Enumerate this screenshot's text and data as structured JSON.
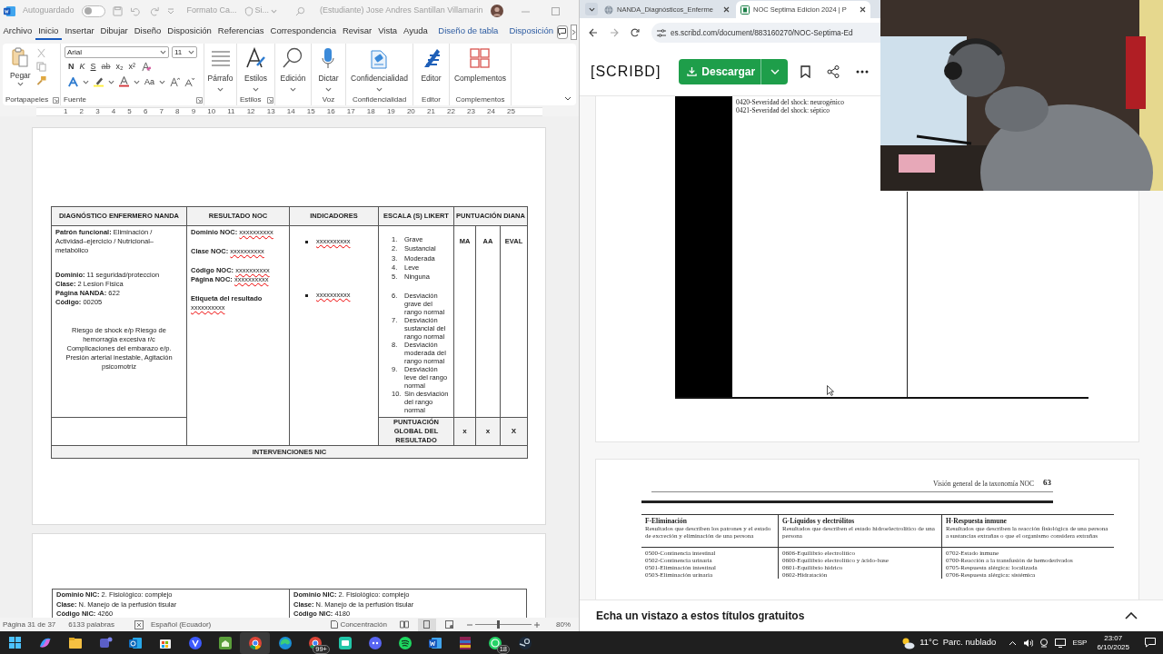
{
  "word": {
    "title_bar": {
      "autosave_label": "Autoguardado",
      "autosave_on": false,
      "file_name": "Formato Ca...",
      "sensitivity": "Si...",
      "user": "(Estudiante) Jose Andres Santillan Villamarin"
    },
    "menu_tabs": [
      {
        "label": "Archivo",
        "selected": false,
        "kind": "main"
      },
      {
        "label": "Inicio",
        "selected": true,
        "kind": "main"
      },
      {
        "label": "Insertar",
        "selected": false,
        "kind": "main"
      },
      {
        "label": "Dibujar",
        "selected": false,
        "kind": "main"
      },
      {
        "label": "Diseño",
        "selected": false,
        "kind": "main"
      },
      {
        "label": "Disposición",
        "selected": false,
        "kind": "main"
      },
      {
        "label": "Referencias",
        "selected": false,
        "kind": "main"
      },
      {
        "label": "Correspondencia",
        "selected": false,
        "kind": "main"
      },
      {
        "label": "Revisar",
        "selected": false,
        "kind": "main"
      },
      {
        "label": "Vista",
        "selected": false,
        "kind": "main"
      },
      {
        "label": "Ayuda",
        "selected": false,
        "kind": "main"
      },
      {
        "label": "Diseño de tabla",
        "selected": false,
        "kind": "context"
      },
      {
        "label": "Disposición",
        "selected": false,
        "kind": "context"
      }
    ],
    "ribbon": {
      "font_name": "Arial",
      "font_size": "11",
      "format_buttons": [
        "N",
        "K",
        "S",
        "ab",
        "x₂",
        "x²"
      ],
      "case_button": "Aa",
      "groups": [
        {
          "kind": "clipboard",
          "label": "Portapapeles",
          "button": "Pegar"
        },
        {
          "kind": "font",
          "label": "Fuente"
        },
        {
          "kind": "paragraph",
          "button": "Párrafo"
        },
        {
          "kind": "styles",
          "label": "Estilos",
          "button": "Estilos"
        },
        {
          "kind": "editing",
          "button": "Edición"
        },
        {
          "kind": "dictate",
          "label": "Voz",
          "button": "Dictar"
        },
        {
          "kind": "sensitivity",
          "label": "Confidencialidad",
          "button": "Confidencialidad"
        },
        {
          "kind": "editor",
          "label": "Editor",
          "button": "Editor"
        },
        {
          "kind": "addins",
          "label": "Complementos",
          "button": "Complementos"
        }
      ]
    },
    "ruler_marks": [
      "1",
      "2",
      "3",
      "4",
      "5",
      "6",
      "7",
      "8",
      "9",
      "10",
      "11",
      "12",
      "13",
      "14",
      "15",
      "16",
      "17",
      "18",
      "19",
      "20",
      "21",
      "22",
      "23",
      "24",
      "25"
    ],
    "care_table": {
      "headers": [
        "DIAGNÓSTICO ENFERMERO NANDA",
        "RESULTADO NOC",
        "INDICADORES",
        "ESCALA (S) LIKERT",
        "PUNTUACIÓN DIANA"
      ],
      "score_headers": [
        "MA",
        "AA",
        "EVAL"
      ],
      "nanda_groups": [
        [
          {
            "label": "Patrón funcional:",
            "value": "Eliminación / Actividad–ejercicio / Nutricional–metabólico"
          }
        ],
        [
          {
            "label": "Dominio:",
            "value": "11 seguridad/proteccion"
          },
          {
            "label": "Clase:",
            "value": "2 Lesion Fisica"
          },
          {
            "label": "Página NANDA:",
            "value": "622"
          },
          {
            "label": "Código:",
            "value": "00205"
          }
        ]
      ],
      "diagnosis": "Riesgo de shock e/p Riesgo de hemorragia excesiva r/c Complicaciones del embarazo e/p. Presión arterial inestable,  Agitación psicomotriz",
      "noc_groups": [
        [
          {
            "label": "Dominio NOC:",
            "value": "xxxxxxxxxx",
            "misspelled": true
          }
        ],
        [
          {
            "label": "Clase NOC:",
            "value": "xxxxxxxxxx",
            "misspelled": true
          }
        ],
        [
          {
            "label": "Código NOC:",
            "value": "xxxxxxxxxx",
            "misspelled": true
          },
          {
            "label": "Página NOC:",
            "value": "xxxxxxxxxx",
            "misspelled": true
          }
        ],
        [
          {
            "label": "Etiqueta del resultado",
            "value": "xxxxxxxxxx",
            "misspelled": true
          }
        ]
      ],
      "indicators": [
        {
          "text": "xxxxxxxxxx",
          "misspelled": true
        },
        {
          "text": "xxxxxxxxxx",
          "misspelled": true
        }
      ],
      "likert_groups": [
        [
          {
            "number": "1.",
            "label": "Grave"
          },
          {
            "number": "2.",
            "label": "Sustancial"
          },
          {
            "number": "3.",
            "label": "Moderada"
          },
          {
            "number": "4.",
            "label": "Leve"
          },
          {
            "number": "5.",
            "label": "Ninguna"
          }
        ],
        [
          {
            "number": "6.",
            "label": "Desviación grave del rango normal"
          },
          {
            "number": "7.",
            "label": "Desviación sustancial del rango normal"
          },
          {
            "number": "8.",
            "label": "Desviación moderada del rango normal"
          },
          {
            "number": "9.",
            "label": "Desviación leve del rango normal"
          },
          {
            "number": "10.",
            "label": "Sin desviación del rango normal"
          }
        ]
      ],
      "total_label": "PUNTUACIÓN GLOBAL DEL RESULTADO",
      "total_values": [
        "x",
        "x",
        "X"
      ],
      "interventions_label": "INTERVENCIONES NIC"
    },
    "nic_cells": [
      [
        {
          "label": "Dominio NIC:",
          "value": "2. Fisiológico: complejo"
        },
        {
          "label": "Clase:",
          "value": "N. Manejo de la perfusión tisular"
        },
        {
          "label": "Código NIC:",
          "value": "4260"
        }
      ],
      [
        {
          "label": "Dominio NIC:",
          "value": "2. Fisiológico: complejo"
        },
        {
          "label": "Clase:",
          "value": "N. Manejo de la perfusión tisular"
        },
        {
          "label": "Código NIC:",
          "value": "4180"
        }
      ]
    ],
    "status_bar": {
      "page": "Página 31 de 37",
      "words": "6133 palabras",
      "language": "Español (Ecuador)",
      "focus": "Concentración",
      "zoom": "80%",
      "zoom_slider": {
        "level": 0.4
      }
    }
  },
  "browser": {
    "tabs": [
      {
        "title": "NANDA_Diagnósticos_Enferme",
        "selected": false,
        "kind": "web"
      },
      {
        "title": "NOC Septima Edicion 2024 | P",
        "selected": true,
        "kind": "scribd"
      }
    ],
    "url": "es.scribd.com/document/883160270/NOC-Septima-Ed",
    "scribd": {
      "logo": "[SCRIBD]",
      "download_button": "Descargar",
      "page_1_lines": [
        "0420-Severidad del shock: neurogénico",
        "0421-Severidad del shock: séptico"
      ],
      "page_2": {
        "running_head": "Visión general de la taxonomía NOC",
        "page_number": "63",
        "columns": [
          {
            "title": "F-Eliminación",
            "description": "Resultados que describen los patrones y el estado de excreción y eliminación de una persona",
            "items": [
              "0500-Continencia intestinal",
              "0502-Continencia urinaria",
              "0501-Eliminación intestinal",
              "0503-Eliminación urinaria"
            ]
          },
          {
            "title": "G-Líquidos y electrólitos",
            "description": "Resultados que describen el estado hidroelectrolítico de una persona",
            "items": [
              "0606-Equilibrio electrolítico",
              "0600-Equilibrio electrolítico y ácido-base",
              "0601-Equilibrio hídrico",
              "0602-Hidratación"
            ]
          },
          {
            "title": "H-Respuesta inmune",
            "description": "Resultados que describen la reacción fisiológica de una persona a sustancias extrañas o que el organismo considera extrañas",
            "items": [
              "0702-Estado inmune",
              "0700-Reacción a la transfusión de hemoderivados",
              "0705-Respuesta alérgica: localizada",
              "0706-Respuesta alérgica: sistémica"
            ]
          }
        ]
      },
      "suggestions_bar": "Echa un vistazo a estos títulos gratuitos"
    }
  },
  "taskbar": {
    "apps": [
      {
        "kind": "start"
      },
      {
        "kind": "copilot"
      },
      {
        "kind": "files"
      },
      {
        "kind": "teams"
      },
      {
        "kind": "outlook"
      },
      {
        "kind": "store"
      },
      {
        "kind": "vpn"
      },
      {
        "kind": "house"
      },
      {
        "kind": "chrome",
        "selected": true
      },
      {
        "kind": "edge"
      },
      {
        "kind": "chrome",
        "badge": "99+"
      },
      {
        "kind": "chat"
      },
      {
        "kind": "discord"
      },
      {
        "kind": "music"
      },
      {
        "kind": "word"
      },
      {
        "kind": "archive"
      },
      {
        "kind": "whatsapp",
        "badge": "18"
      },
      {
        "kind": "steam"
      }
    ],
    "weather_temp": "11°C",
    "weather_text": "Parc. nublado",
    "language": "ESP",
    "time": "23:07",
    "date": "6/10/2025"
  }
}
